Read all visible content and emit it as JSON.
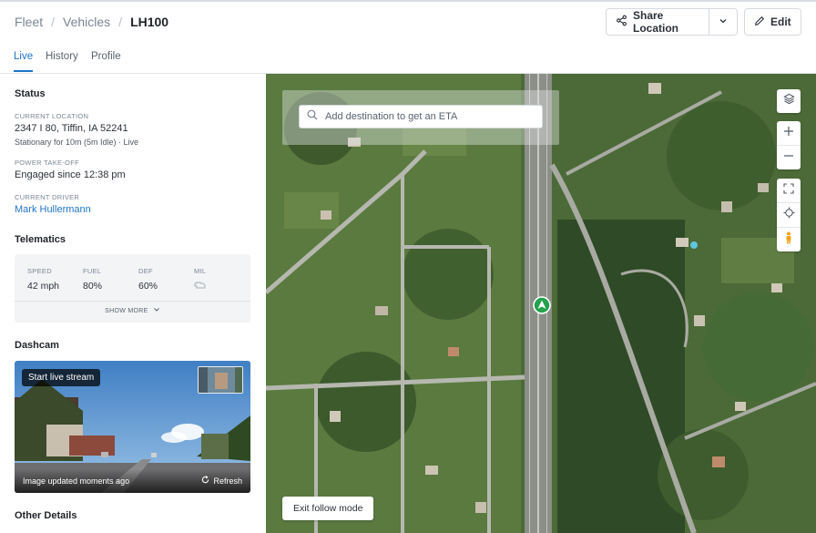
{
  "breadcrumb": {
    "fleet": "Fleet",
    "vehicles": "Vehicles",
    "current": "LH100",
    "separator": "/"
  },
  "actions": {
    "share_label": "Share Location",
    "edit_label": "Edit"
  },
  "tabs": [
    {
      "label": "Live",
      "active": true
    },
    {
      "label": "History",
      "active": false
    },
    {
      "label": "Profile",
      "active": false
    }
  ],
  "status": {
    "title": "Status",
    "location_label": "CURRENT LOCATION",
    "location_value": "2347 I 80, Tiffin, IA 52241",
    "location_sub": "Stationary for 10m (5m Idle) · Live",
    "pto_label": "POWER TAKE-OFF",
    "pto_value": "Engaged since 12:38 pm",
    "driver_label": "CURRENT DRIVER",
    "driver_value": "Mark Hullermann"
  },
  "telematics": {
    "title": "Telematics",
    "metrics": [
      {
        "label": "SPEED",
        "value": "42 mph"
      },
      {
        "label": "FUEL",
        "value": "80%"
      },
      {
        "label": "DEF",
        "value": "60%"
      },
      {
        "label": "MIL",
        "value": ""
      }
    ],
    "show_more": "SHOW MORE"
  },
  "dashcam": {
    "title": "Dashcam",
    "live_label": "Start live stream",
    "updated_text": "Image updated moments ago",
    "refresh_label": "Refresh"
  },
  "other_details": {
    "title": "Other Details"
  },
  "map": {
    "search_placeholder": "Add destination to get an ETA",
    "exit_follow_label": "Exit follow mode"
  },
  "colors": {
    "accent": "#1f74c8",
    "vehicle_marker": "#22a24a"
  },
  "icons": [
    "share-icon",
    "chevron-down-icon",
    "pencil-icon",
    "engine-icon",
    "refresh-icon",
    "search-icon",
    "layers-icon",
    "plus-icon",
    "minus-icon",
    "fullscreen-icon",
    "crosshair-icon",
    "pegman-icon",
    "vehicle-arrow-icon"
  ]
}
